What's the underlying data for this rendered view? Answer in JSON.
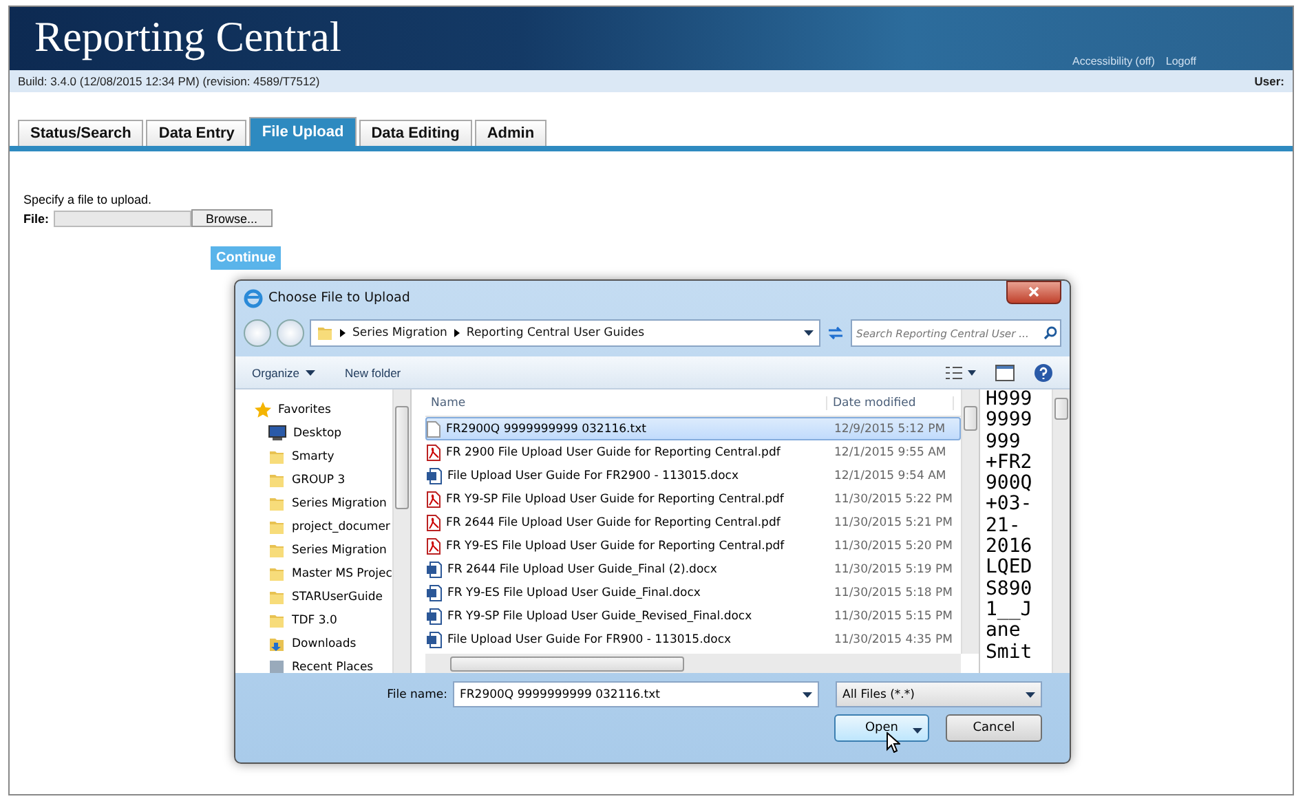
{
  "header": {
    "title": "Reporting Central",
    "links": [
      "Accessibility (off)",
      "Logoff"
    ],
    "build": "Build: 3.4.0 (12/08/2015 12:34 PM) (revision: 4589/T7512)",
    "user": "User:"
  },
  "tabs": [
    {
      "label": "Status/Search",
      "selected": false
    },
    {
      "label": "Data Entry",
      "selected": false
    },
    {
      "label": "File Upload",
      "selected": true
    },
    {
      "label": "Data Editing",
      "selected": false
    },
    {
      "label": "Admin",
      "selected": false
    }
  ],
  "upload": {
    "prompt": "Specify a file to upload.",
    "file_label": "File:",
    "browse": "Browse...",
    "continue": "Continue"
  },
  "dialog": {
    "title": "Choose File to Upload",
    "path": [
      "Series Migration",
      "Reporting Central User Guides"
    ],
    "search_placeholder": "Search Reporting Central User ...",
    "organize": "Organize",
    "new_folder": "New folder",
    "nav": [
      {
        "kind": "favorites",
        "label": "Favorites"
      },
      {
        "kind": "desktop",
        "label": "Desktop"
      },
      {
        "kind": "folder",
        "label": "Smarty"
      },
      {
        "kind": "folder",
        "label": "GROUP 3"
      },
      {
        "kind": "folder",
        "label": "Series Migration"
      },
      {
        "kind": "folder",
        "label": "project_documer"
      },
      {
        "kind": "folder",
        "label": "Series Migration"
      },
      {
        "kind": "folder",
        "label": "Master MS Projec"
      },
      {
        "kind": "folder",
        "label": "STARUserGuide"
      },
      {
        "kind": "folder",
        "label": "TDF 3.0"
      },
      {
        "kind": "downloads",
        "label": "Downloads"
      },
      {
        "kind": "recent",
        "label": "Recent Places"
      }
    ],
    "columns": [
      "Name",
      "Date modified"
    ],
    "files": [
      {
        "kind": "txt",
        "name": "FR2900Q 9999999999 032116.txt",
        "date": "12/9/2015 5:12 PM",
        "selected": true
      },
      {
        "kind": "pdf",
        "name": "FR 2900 File Upload User Guide for Reporting Central.pdf",
        "date": "12/1/2015 9:55 AM",
        "selected": false
      },
      {
        "kind": "docx",
        "name": "File Upload User Guide For FR2900 - 113015.docx",
        "date": "12/1/2015 9:54 AM",
        "selected": false
      },
      {
        "kind": "pdf",
        "name": "FR Y9-SP File Upload User Guide for Reporting Central.pdf",
        "date": "11/30/2015 5:22 PM",
        "selected": false
      },
      {
        "kind": "pdf",
        "name": "FR 2644 File Upload User Guide for Reporting Central.pdf",
        "date": "11/30/2015 5:21 PM",
        "selected": false
      },
      {
        "kind": "pdf",
        "name": "FR Y9-ES File Upload User Guide for Reporting Central.pdf",
        "date": "11/30/2015 5:20 PM",
        "selected": false
      },
      {
        "kind": "docx",
        "name": "FR 2644 File Upload User Guide_Final (2).docx",
        "date": "11/30/2015 5:19 PM",
        "selected": false
      },
      {
        "kind": "docx",
        "name": "FR Y9-ES File Upload User Guide_Final.docx",
        "date": "11/30/2015 5:18 PM",
        "selected": false
      },
      {
        "kind": "docx",
        "name": "FR Y9-SP File Upload User Guide_Revised_Final.docx",
        "date": "11/30/2015 5:15 PM",
        "selected": false
      },
      {
        "kind": "docx",
        "name": "File Upload User Guide For FR900 - 113015.docx",
        "date": "11/30/2015 4:35 PM",
        "selected": false
      }
    ],
    "preview": [
      "H999",
      "9999",
      "999",
      "+FR2",
      "900Q",
      "+03-",
      "21-",
      "2016",
      "LQED",
      "S890",
      "1__J",
      "ane",
      "Smit"
    ],
    "file_name_label": "File name:",
    "file_name": "FR2900Q 9999999999 032116.txt",
    "filter": "All Files (*.*)",
    "open": "Open",
    "cancel": "Cancel"
  }
}
